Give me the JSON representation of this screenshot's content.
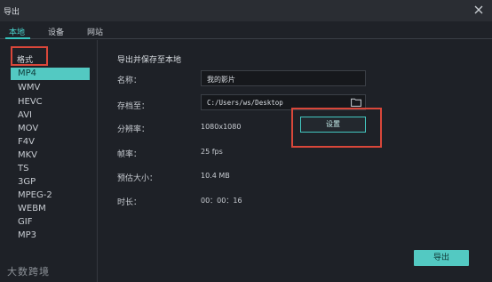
{
  "window": {
    "title": "导出"
  },
  "tabs": [
    {
      "label": "本地"
    },
    {
      "label": "设备"
    },
    {
      "label": "网站"
    }
  ],
  "sidebar": {
    "format_label": "格式",
    "formats": [
      "MP4",
      "WMV",
      "HEVC",
      "AVI",
      "MOV",
      "F4V",
      "MKV",
      "TS",
      "3GP",
      "MPEG-2",
      "WEBM",
      "GIF",
      "MP3"
    ],
    "selected": "MP4"
  },
  "main": {
    "section_title": "导出并保存至本地",
    "name_label": "名称：",
    "name_value": "我的影片",
    "save_label": "存档至：",
    "save_path": "C:/Users/ws/Desktop",
    "resolution_label": "分辨率：",
    "resolution_value": "1080x1080",
    "settings_button": "设置",
    "fps_label": "帧率：",
    "fps_value": "25 fps",
    "size_label": "预估大小：",
    "size_value": "10.4 MB",
    "duration_label": "时长：",
    "duration_value": "00：00：16",
    "export_button": "导出"
  },
  "watermark": "大数跨境",
  "colors": {
    "accent": "#53c9c2",
    "highlight_box": "#d9473a",
    "background": "#1e2127"
  }
}
